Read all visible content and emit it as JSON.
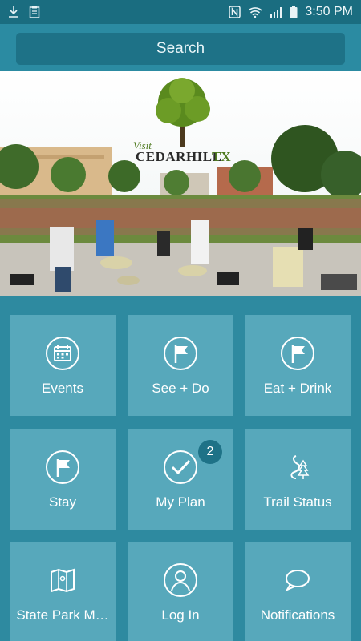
{
  "status_bar": {
    "left_icons": [
      "download-icon",
      "clipboard-icon"
    ],
    "right_icons": [
      "nfc-icon",
      "wifi-icon",
      "signal-icon",
      "battery-icon"
    ],
    "time": "3:50 PM"
  },
  "header": {
    "search_label": "Search"
  },
  "hero": {
    "logo_visit": "Visit",
    "logo_name": "CEDARHILL",
    "logo_suffix": "TX"
  },
  "tiles": [
    {
      "label": "Events",
      "icon": "calendar-icon"
    },
    {
      "label": "See + Do",
      "icon": "flag-icon"
    },
    {
      "label": "Eat + Drink",
      "icon": "flag-icon"
    },
    {
      "label": "Stay",
      "icon": "flag-icon"
    },
    {
      "label": "My Plan",
      "icon": "checkmark-icon",
      "badge": "2"
    },
    {
      "label": "Trail Status",
      "icon": "trail-icon"
    },
    {
      "label": "State Park M…",
      "icon": "map-icon"
    },
    {
      "label": "Log In",
      "icon": "user-icon"
    },
    {
      "label": "Notifications",
      "icon": "chat-bubble-icon"
    }
  ],
  "colors": {
    "status_bar": "#1a6d80",
    "header": "#2b8ba2",
    "search_bar": "#1e7287",
    "tile": "#57a8bb",
    "background": "#2e8aa0"
  }
}
